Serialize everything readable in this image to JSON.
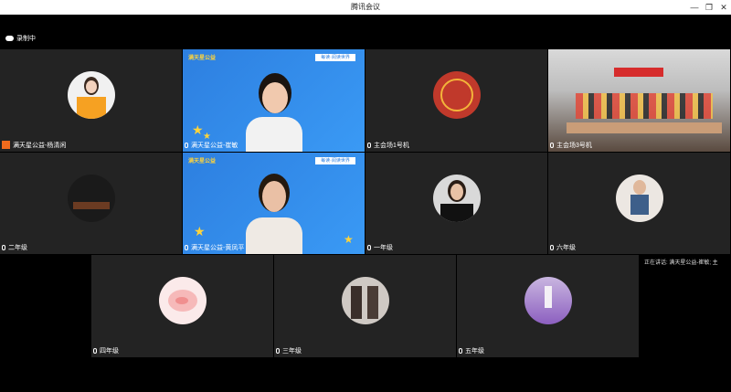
{
  "window": {
    "title": "腾讯会议"
  },
  "recording": {
    "label": "录制中"
  },
  "tiles": [
    {
      "id": "yang",
      "label": "满天星公益-杨清闲"
    },
    {
      "id": "cui",
      "label": "满天星公益-崔敏",
      "logo": "满天星公益",
      "banner": "每读·阅读世界"
    },
    {
      "id": "main1",
      "label": "主会场1号机"
    },
    {
      "id": "main3",
      "label": "主会场3号机"
    },
    {
      "id": "g2",
      "label": "二年级"
    },
    {
      "id": "huang",
      "label": "满天星公益-黄凤平",
      "logo": "满天星公益",
      "banner": "每读·阅读世界"
    },
    {
      "id": "g1",
      "label": "一年级"
    },
    {
      "id": "g6",
      "label": "六年级"
    },
    {
      "id": "g4",
      "label": "四年级"
    },
    {
      "id": "g3",
      "label": "三年级"
    },
    {
      "id": "g5",
      "label": "五年级"
    }
  ],
  "speaking": {
    "text": "正在讲话: 满天星公益-崔敏; 主"
  },
  "icons": {
    "minimize": "minimize-icon",
    "restore": "restore-icon",
    "close": "close-icon",
    "mic": "mic-icon",
    "cloud": "cloud-record-icon"
  },
  "colors": {
    "tile_bg": "#232323",
    "stage_bg": "#000000",
    "accent_blue": "#2d7fe0",
    "badge_orange": "#f26b1d"
  }
}
